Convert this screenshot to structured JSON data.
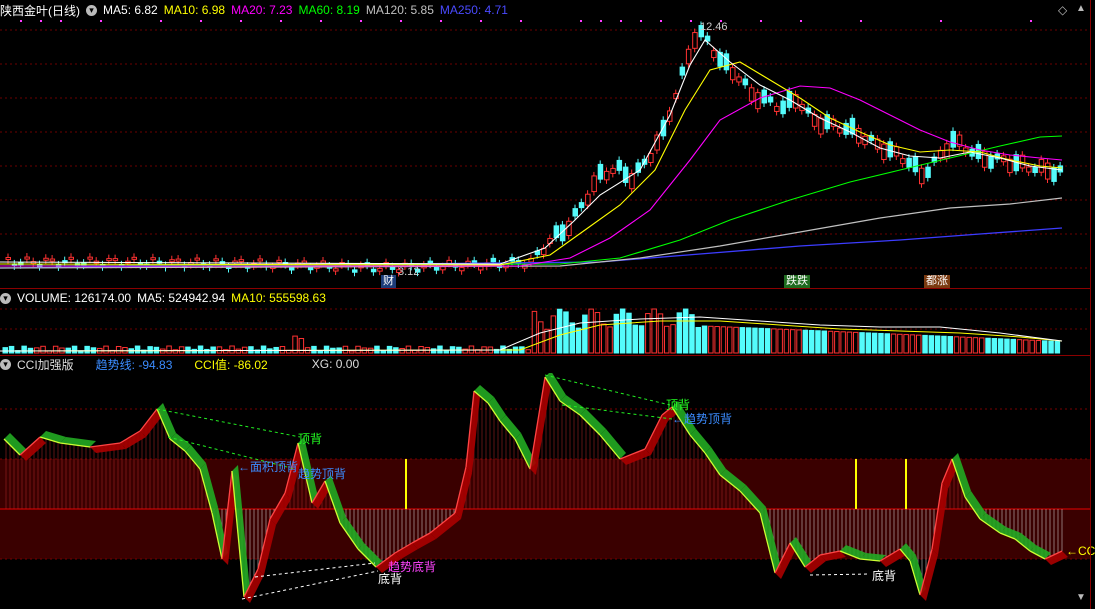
{
  "main_header": {
    "stock_name": "陕西金叶",
    "period": "(日线)",
    "ma5": "MA5: 6.82",
    "ma10": "MA10: 6.98",
    "ma20": "MA20: 7.23",
    "ma60": "MA60: 8.19",
    "ma120": "MA120: 5.85",
    "ma250": "MA250: 4.71"
  },
  "main_annotations": {
    "high_label": "12.46",
    "low_label": "3.12",
    "event_cai": "财",
    "event_diedie": "跌跌",
    "event_zhangzhang": "都涨"
  },
  "volume_header": {
    "title": "VOLUME: 126174.00",
    "ma5": "MA5: 524942.94",
    "ma10": "MA10: 555598.63"
  },
  "cci_header": {
    "title": "CCI加强版",
    "trend_line": "趋势线: -94.83",
    "cci_value": "CCI值: -86.02",
    "xg": "XG: 0.00"
  },
  "cci_annotations": {
    "top_div_1": "顶背",
    "area_top_div": "←面积顶背",
    "trend_top_div_1": "趋势顶背",
    "top_div_2": "顶背",
    "trend_top_div_2": "←趋势顶背",
    "trend_bottom_div": "趋势底背",
    "bottom_div_1": "底背",
    "bottom_div_2": "底背",
    "cci_edge": "←CC"
  },
  "colors": {
    "up": "#ff3232",
    "down": "#54fcfc",
    "ma5": "#ffffff",
    "ma10": "#ffff00",
    "ma20": "#ff00ff",
    "ma60": "#00ff00",
    "ma120": "#c0c0c0",
    "ma250": "#3c3cff",
    "cci_green": "#22aa22",
    "cci_red": "#aa0000"
  },
  "icons": {
    "settings": "settings-circle-icon",
    "diamond": "diamond-icon",
    "scroll_up": "scroll-up-icon",
    "scroll_down": "scroll-down-icon"
  }
}
